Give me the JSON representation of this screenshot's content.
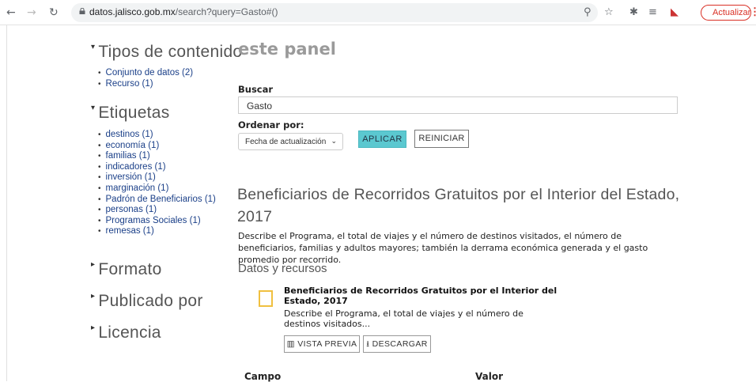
{
  "browser": {
    "url_host": "datos.jalisco.gob.mx",
    "url_path": "/search?query=Gasto#()",
    "update_label": "Actualizar"
  },
  "main": {
    "title": "este panel",
    "search_label": "Buscar",
    "search_value": "Gasto",
    "sort_label": "Ordenar por:",
    "sort_selected": "Fecha de actualización",
    "apply_label": "APLICAR",
    "reset_label": "REINICIAR"
  },
  "sidebar": {
    "facets": [
      {
        "title": "Tipos de contenido",
        "items": [
          "Conjunto de datos (2)",
          "Recurso (1)"
        ]
      },
      {
        "title": "Etiquetas",
        "items": [
          "destinos (1)",
          "economía (1)",
          "familias (1)",
          "indicadores (1)",
          "inversión (1)",
          "marginación (1)",
          "Padrón de Beneficiarios (1)",
          "personas (1)",
          "Programas Sociales (1)",
          "remesas (1)"
        ]
      },
      {
        "title": "Formato",
        "items": []
      },
      {
        "title": "Publicado por",
        "items": []
      },
      {
        "title": "Licencia",
        "items": []
      }
    ]
  },
  "result": {
    "title": "Beneficiarios de Recorridos Gratuitos por el Interior del Estado, 2017",
    "description": "Describe el Programa, el total de viajes y el número de destinos visitados, el número de beneficiarios, familias y adultos mayores; también la derrama económica generada y el gasto promedio por recorrido.",
    "resources_heading": "Datos y recursos",
    "resource": {
      "title": "Beneficiarios de Recorridos Gratuitos por el Interior del Estado, 2017",
      "description": "Describe el Programa, el total de viajes y el número de destinos visitados...",
      "preview_label": "VISTA PREVIA",
      "download_label": "DESCARGAR"
    },
    "table_headers": [
      "Campo",
      "Valor"
    ]
  }
}
